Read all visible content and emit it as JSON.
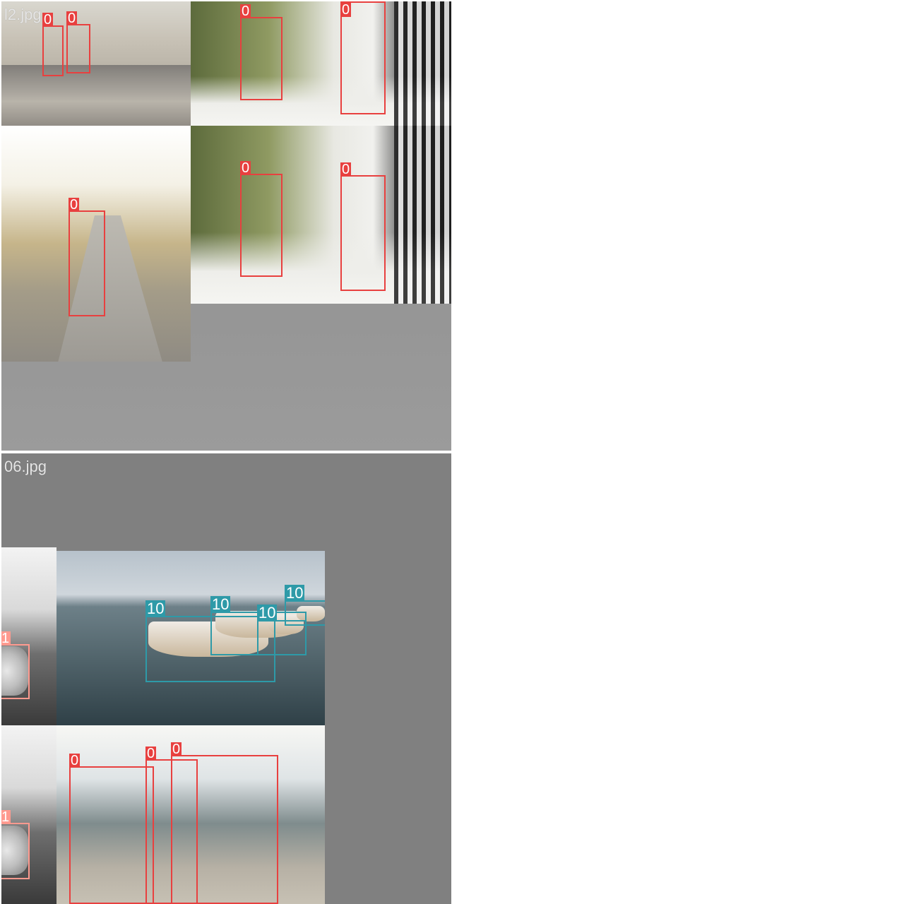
{
  "mosaic_top": {
    "filename": "l2.jpg"
  },
  "mosaic_bottom": {
    "filename": "06.jpg"
  },
  "classes": {
    "person": "0",
    "car": "1",
    "boat": "10"
  },
  "colors": {
    "person": "#e8403f",
    "boat": "#2e9aa8",
    "car": "#ff9a8f"
  }
}
